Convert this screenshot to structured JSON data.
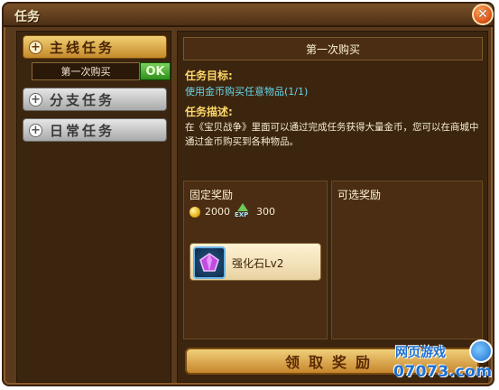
{
  "window": {
    "title": "任务",
    "close_glyph": "✕"
  },
  "sidebar": {
    "categories": [
      {
        "label": "主线任务",
        "icon": "plus-icon"
      },
      {
        "label": "分支任务",
        "icon": "plus-icon"
      },
      {
        "label": "日常任务",
        "icon": "plus-icon"
      }
    ],
    "plus_glyph": "+",
    "quest": {
      "name": "第一次购买",
      "status": "OK"
    }
  },
  "detail": {
    "header": "第一次购买",
    "goal_label": "任务目标:",
    "goal_text": "使用金币购买任意物品(1/1)",
    "desc_label": "任务描述:",
    "desc_text": "在《宝贝战争》里面可以通过完成任务获得大量金币，您可以在商城中通过金币购买到各种物品。"
  },
  "rewards": {
    "fixed_title": "固定奖励",
    "optional_title": "可选奖励",
    "gold": "2000",
    "exp_label": "EXP",
    "exp": "300",
    "item_name": "强化石Lv2"
  },
  "claim_button": "领取奖励",
  "watermark": {
    "top": "网页游戏",
    "bottom": "07073.com"
  },
  "colors": {
    "panel": "#3c250f",
    "accent_gold": "#ffd86a",
    "goal_cyan": "#67d6e8",
    "ok_green": "#2f8f1c"
  }
}
